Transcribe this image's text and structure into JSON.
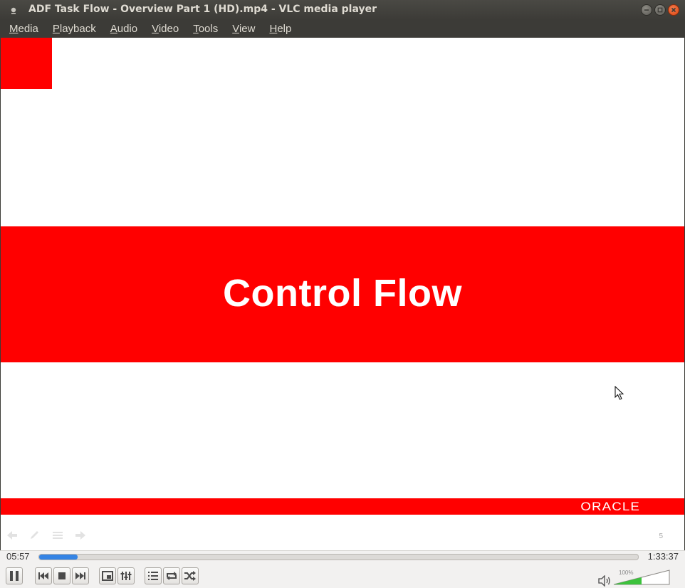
{
  "window": {
    "title": "ADF Task Flow - Overview Part 1 (HD).mp4 - VLC media player",
    "buttons": {
      "minimize": "minimize-icon",
      "maximize": "maximize-icon",
      "close": "close-icon"
    }
  },
  "menu": [
    {
      "mnemonic": "M",
      "rest": "edia"
    },
    {
      "mnemonic": "P",
      "rest": "layback"
    },
    {
      "mnemonic": "A",
      "rest": "udio"
    },
    {
      "mnemonic": "V",
      "rest": "ideo"
    },
    {
      "mnemonic": "T",
      "rest": "ools"
    },
    {
      "mnemonic": "V",
      "rest": "iew"
    },
    {
      "mnemonic": "H",
      "rest": "elp"
    }
  ],
  "slide": {
    "title": "Control Flow",
    "logo_text": "ORACLE",
    "slide_number": "5",
    "colors": {
      "brand_red": "#ff0000",
      "background": "#ffffff"
    }
  },
  "player": {
    "elapsed": "05:57",
    "total": "1:33:37",
    "progress_fraction": 0.0637,
    "volume_label": "100%",
    "volume_fraction": 0.5,
    "accent": "#3584e4",
    "volume_color": "#3cc23c",
    "buttons": [
      {
        "name": "pause-button",
        "icon": "pause-icon"
      },
      {
        "name": "previous-button",
        "icon": "skip-back-icon"
      },
      {
        "name": "stop-button",
        "icon": "stop-icon"
      },
      {
        "name": "next-button",
        "icon": "skip-forward-icon"
      },
      {
        "name": "fullscreen-button",
        "icon": "fullscreen-icon"
      },
      {
        "name": "extended-settings-button",
        "icon": "equalizer-icon"
      },
      {
        "name": "playlist-button",
        "icon": "playlist-icon"
      },
      {
        "name": "loop-button",
        "icon": "loop-icon"
      },
      {
        "name": "shuffle-button",
        "icon": "shuffle-icon"
      }
    ]
  }
}
